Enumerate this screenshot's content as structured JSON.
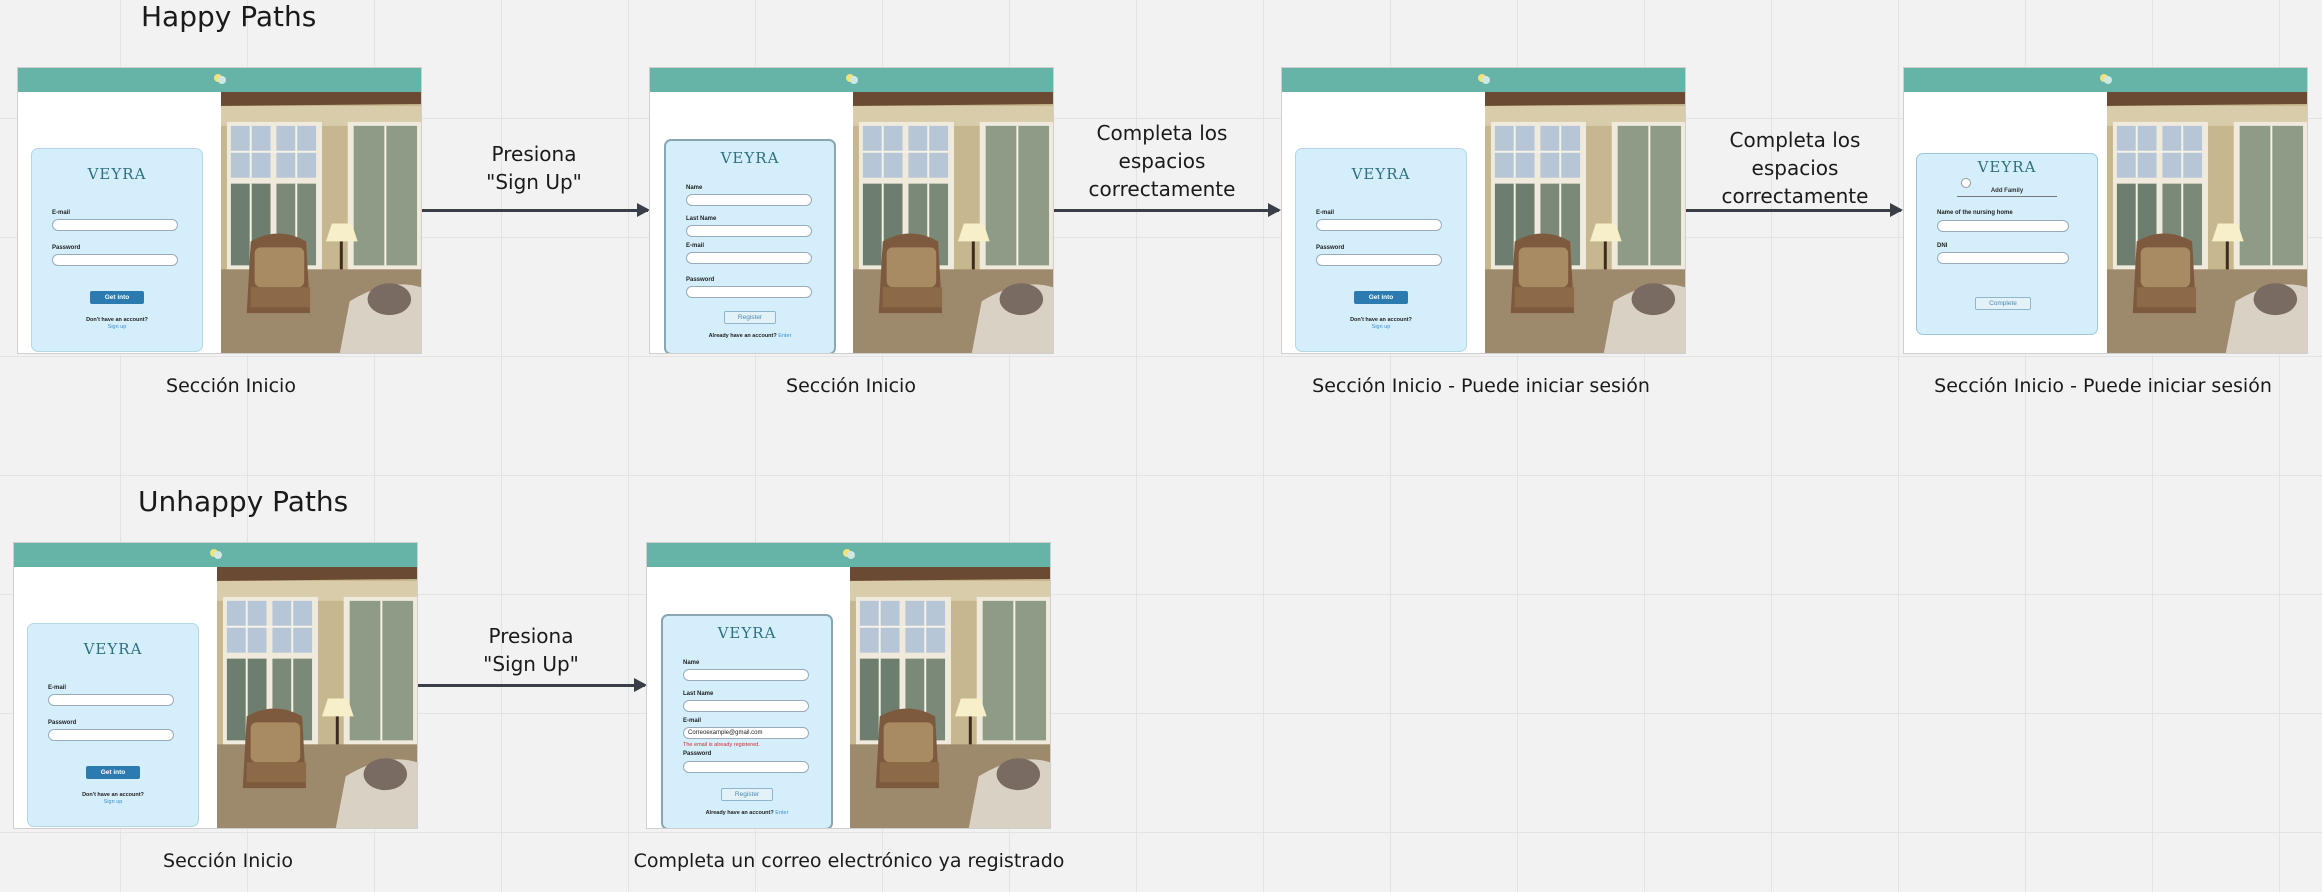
{
  "headings": {
    "happy": "Happy Paths",
    "unhappy": "Unhappy Paths"
  },
  "captions": {
    "h1": "Sección Inicio",
    "h2": "Sección Inicio",
    "h3": "Sección Inicio - Puede iniciar sesión",
    "h4": "Sección Inicio - Puede iniciar sesión",
    "u1": "Sección Inicio",
    "u2": "Completa un correo electrónico ya registrado"
  },
  "arrows": {
    "h1": [
      "Presiona",
      "\"Sign Up\""
    ],
    "h2": [
      "Completa los",
      "espacios",
      "correctamente"
    ],
    "h3": [
      "Completa los",
      "espacios",
      "correctamente"
    ],
    "u1": [
      "Presiona",
      "\"Sign Up\""
    ]
  },
  "app": {
    "brand": "VEYRA",
    "login": {
      "email_label": "E-mail",
      "password_label": "Password",
      "button": "Get into",
      "no_account": "Don't have an account?",
      "signup_link": "Sign up"
    },
    "register": {
      "name_label": "Name",
      "lastname_label": "Last Name",
      "email_label": "E-mail",
      "password_label": "Password",
      "button": "Register",
      "have_account": "Already have an account?",
      "enter_link": "Enter"
    },
    "family": {
      "subtitle": "Add Family",
      "nursing_label": "Name of the nursing home",
      "dni_label": "DNI",
      "button": "Complete"
    },
    "error": {
      "email_value": "Correoexample@gmail.com",
      "message": "The email is already registered."
    }
  },
  "colors": {
    "topbar": "#66b3a8",
    "card": "#d4effb",
    "primary_button": "#2b7bb0",
    "arrow": "#3a3f47",
    "error": "#d62a2a"
  }
}
